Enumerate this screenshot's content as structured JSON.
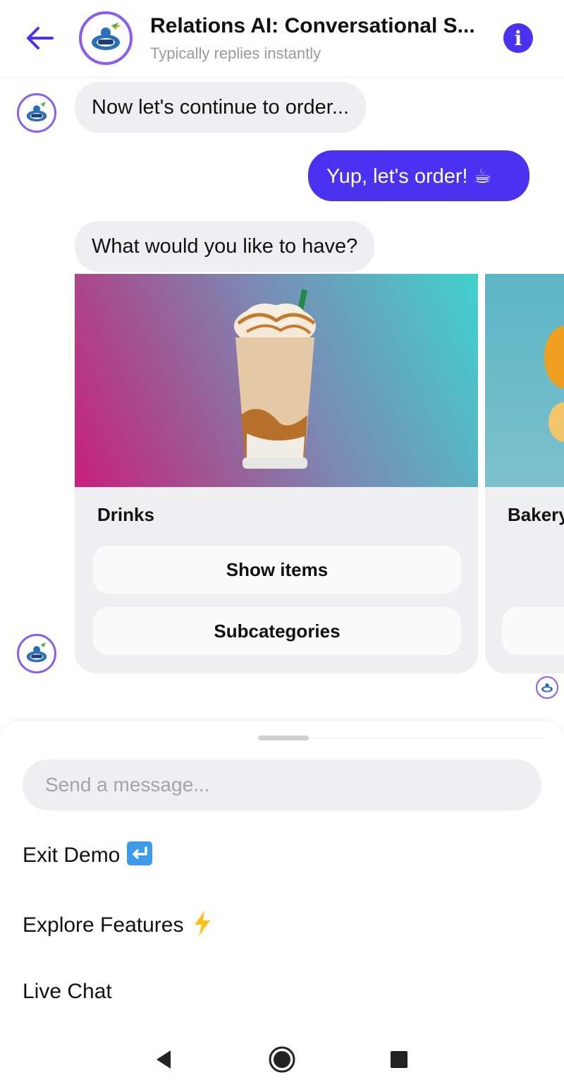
{
  "header": {
    "title": "Relations AI: Conversational S...",
    "subtitle": "Typically replies instantly",
    "back_icon": "arrow-left-icon",
    "info_icon": "info-icon",
    "info_glyph": "i"
  },
  "messages": [
    {
      "from": "bot",
      "text": "Now let's continue to order..."
    },
    {
      "from": "user",
      "text": "Yup, let's order! ☕"
    },
    {
      "from": "bot",
      "text": "What would you like to have?"
    }
  ],
  "carousel": {
    "cards": [
      {
        "title": "Drinks",
        "buttons": [
          "Show items",
          "Subcategories"
        ]
      },
      {
        "title": "Bakery"
      }
    ]
  },
  "composer": {
    "placeholder": "Send a message..."
  },
  "quick_replies": [
    {
      "label": "Exit Demo",
      "emoji": "return-arrow-icon"
    },
    {
      "label": "Explore Features",
      "emoji": "lightning-icon"
    },
    {
      "label": "Live Chat"
    }
  ],
  "navbar": {
    "back": "nav-back-icon",
    "home": "nav-home-icon",
    "recents": "nav-recents-icon"
  },
  "colors": {
    "accent": "#4a32f0",
    "avatar_ring": "#8a5cf6",
    "bubble_bot": "#efeff2"
  }
}
